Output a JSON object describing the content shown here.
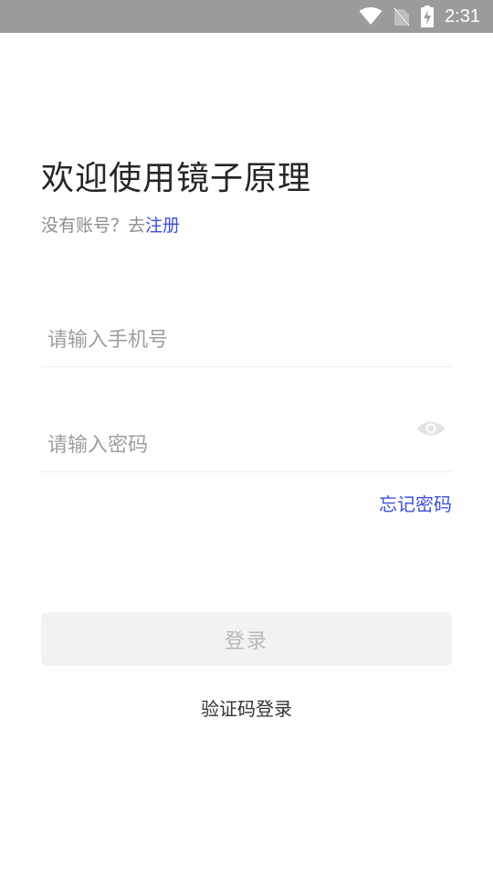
{
  "status_bar": {
    "time": "2:31",
    "icons": [
      "wifi-icon",
      "no-sim-icon",
      "battery-charging-icon"
    ]
  },
  "header": {
    "title": "欢迎使用镜子原理",
    "no_account_text": "没有账号？去",
    "register_link": "注册"
  },
  "form": {
    "phone_placeholder": "请输入手机号",
    "password_placeholder": "请输入密码",
    "password_visibility_icon": "eye-icon",
    "forgot_password": "忘记密码",
    "login_button": "登录",
    "code_login": "验证码登录"
  },
  "colors": {
    "status_bar": "#9b9b9b",
    "link": "#3f51d8",
    "button_bg": "#f2f2f2",
    "button_text": "#b8b8b8"
  }
}
